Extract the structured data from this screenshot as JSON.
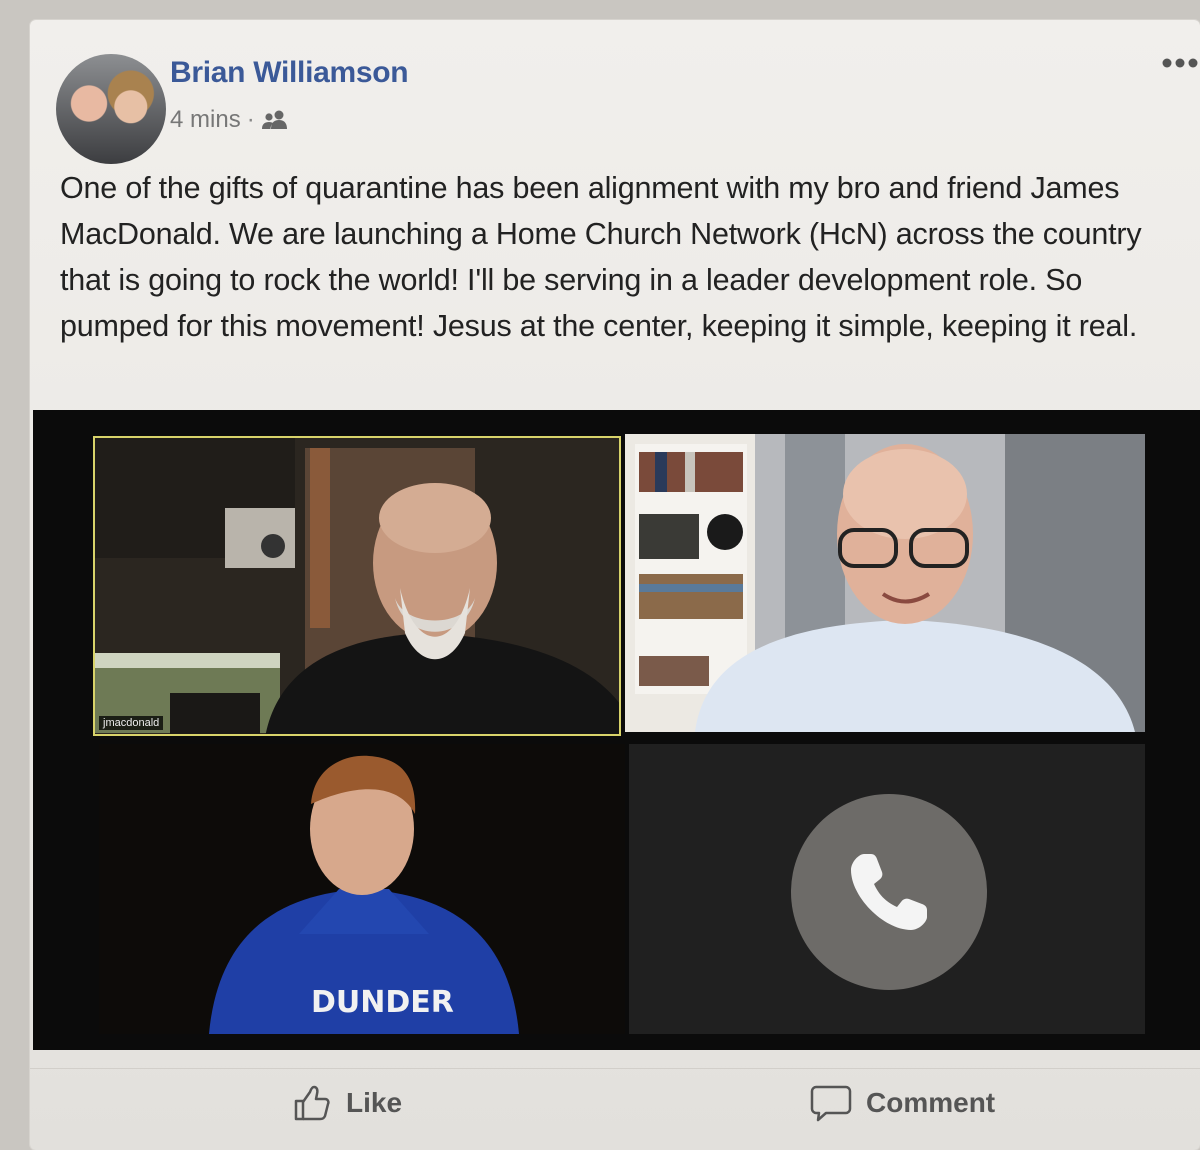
{
  "post": {
    "author": "Brian Williamson",
    "time": "4 mins",
    "separator": "·",
    "audience_icon": "friends-icon",
    "text": "One of the gifts of quarantine has been alignment with my bro and friend James MacDonald. We are launching a Home Church Network (HcN) across the country that is going to rock the world! I'll be serving in a leader development role. So pumped for this movement! Jesus at the center, keeping it simple, keeping it real."
  },
  "video_call": {
    "participants": [
      {
        "name_label": "jmacdonald",
        "active_speaker": true
      },
      {
        "name_label": ""
      },
      {
        "name_label": "",
        "shirt_text": "DUNDER"
      },
      {
        "audio_only": true,
        "icon": "phone-icon"
      }
    ]
  },
  "actions": {
    "like_label": "Like",
    "comment_label": "Comment"
  },
  "colors": {
    "author": "#3b5998",
    "speaker_border": "#d8d36a"
  }
}
